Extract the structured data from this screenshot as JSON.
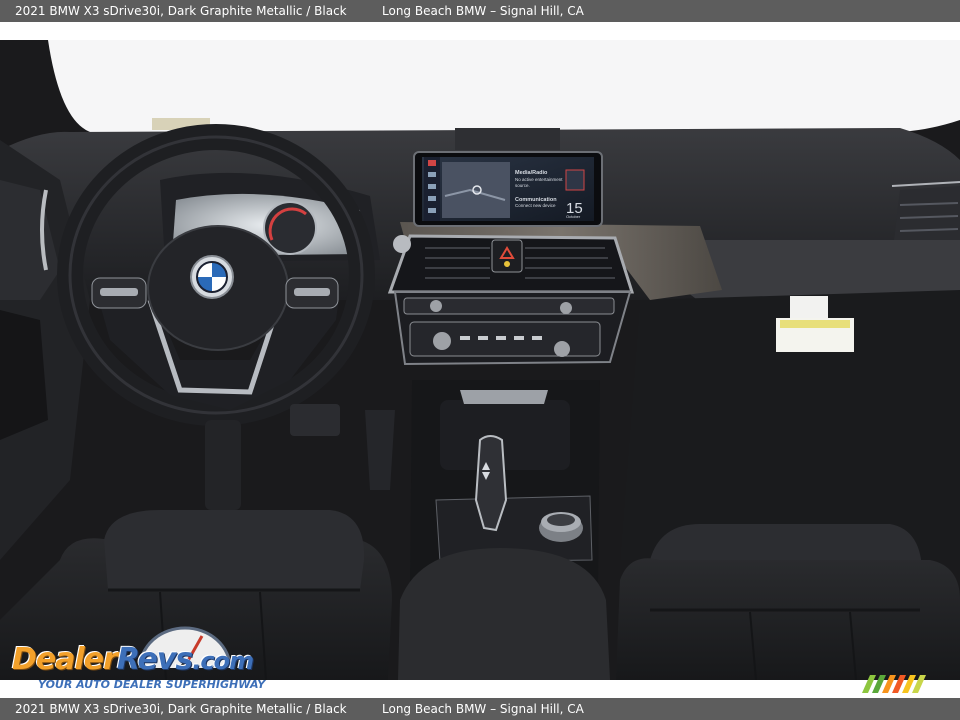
{
  "caption": {
    "vehicle": "2021 BMW X3 sDrive30i,  Dark Graphite Metallic / Black",
    "dealer": "Long Beach BMW – Signal Hill, CA"
  },
  "infotainment": {
    "item1_title": "Media/Radio",
    "item1_line1": "No active entertainment",
    "item1_line2": "source.",
    "item2_title": "Communication",
    "item2_line1": "Connect new device",
    "date_day": "15",
    "date_month": "October"
  },
  "watermark": {
    "dealer": "Dealer",
    "revs": "Revs",
    "com": ".com",
    "tagline": "YOUR AUTO DEALER SUPERHIGHWAY",
    "gauge_digits": "4 5 6"
  },
  "colors": {
    "caption_bar": "#5d5d5d",
    "caption_text": "#ffffff",
    "watermark_orange": "#f2a02a",
    "watermark_blue": "#3d6fb8"
  },
  "icons": [
    "bmw-logo-icon",
    "gear-selector-icon",
    "hazard-icon",
    "rotary-controller-icon",
    "dealer-stripes-logo"
  ]
}
